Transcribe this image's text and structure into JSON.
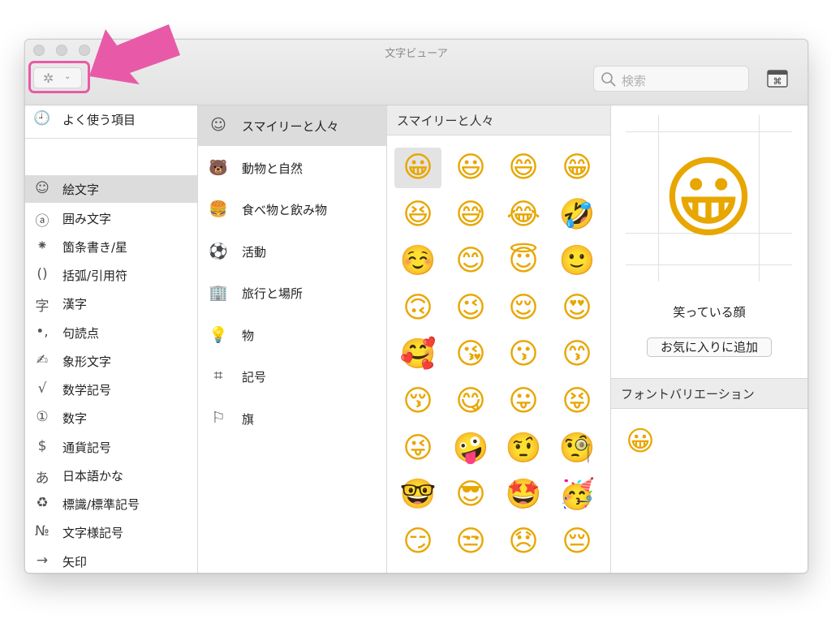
{
  "window": {
    "title": "文字ビューア"
  },
  "toolbar": {
    "gear_glyph": "✲",
    "chevron_glyph": "⌄",
    "search_placeholder": "検索",
    "keyboard_glyph": "⌘"
  },
  "colors": {
    "highlight": "#e85aa7",
    "selected_row": "#dcdcdc",
    "emoji": "#e8a600"
  },
  "categories": [
    {
      "icon": "clock-icon",
      "glyph": "🕘",
      "label": "よく使う項目"
    },
    {
      "icon": "smiley-icon",
      "glyph": "☺",
      "label": "絵文字"
    },
    {
      "icon": "circled-a-icon",
      "glyph": "ⓐ",
      "label": "囲み文字"
    },
    {
      "icon": "asterisk-icon",
      "glyph": "⁕",
      "label": "箇条書き/星"
    },
    {
      "icon": "parentheses-icon",
      "glyph": "()",
      "label": "括弧/引用符"
    },
    {
      "icon": "kanji-icon",
      "glyph": "字",
      "label": "漢字"
    },
    {
      "icon": "punctuation-icon",
      "glyph": "•,",
      "label": "句読点"
    },
    {
      "icon": "pictograph-icon",
      "glyph": "✍",
      "label": "象形文字"
    },
    {
      "icon": "sqrt-icon",
      "glyph": "√",
      "label": "数学記号"
    },
    {
      "icon": "circled-one-icon",
      "glyph": "①",
      "label": "数字"
    },
    {
      "icon": "dollar-icon",
      "glyph": "$",
      "label": "通貨記号"
    },
    {
      "icon": "hiragana-icon",
      "glyph": "あ",
      "label": "日本語かな"
    },
    {
      "icon": "recycle-icon",
      "glyph": "♻",
      "label": "標識/標準記号"
    },
    {
      "icon": "numero-icon",
      "glyph": "№",
      "label": "文字様記号"
    },
    {
      "icon": "arrow-icon",
      "glyph": "→",
      "label": "矢印"
    }
  ],
  "subcategories": [
    {
      "icon": "smiley-icon",
      "glyph": "☺",
      "label": "スマイリーと人々"
    },
    {
      "icon": "bear-icon",
      "glyph": "🐻",
      "label": "動物と自然"
    },
    {
      "icon": "food-icon",
      "glyph": "🍔",
      "label": "食べ物と飲み物"
    },
    {
      "icon": "soccer-ball-icon",
      "glyph": "⚽",
      "label": "活動"
    },
    {
      "icon": "building-icon",
      "glyph": "🏢",
      "label": "旅行と場所"
    },
    {
      "icon": "lightbulb-icon",
      "glyph": "💡",
      "label": "物"
    },
    {
      "icon": "symbols-icon",
      "glyph": "⌗",
      "label": "記号"
    },
    {
      "icon": "flag-icon",
      "glyph": "⚐",
      "label": "旗"
    }
  ],
  "grid": {
    "header": "スマイリーと人々",
    "emojis": [
      "😀",
      "😃",
      "😄",
      "😁",
      "😆",
      "😅",
      "😂",
      "🤣",
      "☺️",
      "😊",
      "😇",
      "🙂",
      "🙃",
      "😉",
      "😌",
      "😍",
      "🥰",
      "😘",
      "😗",
      "😙",
      "😚",
      "😋",
      "😛",
      "😝",
      "😜",
      "🤪",
      "🤨",
      "🧐",
      "🤓",
      "😎",
      "🤩",
      "🥳",
      "😏",
      "😒",
      "😞",
      "😔"
    ]
  },
  "detail": {
    "emoji": "😀",
    "name": "笑っている顔",
    "add_favorite": "お気に入りに追加",
    "variations_header": "フォントバリエーション",
    "variations": [
      "😀"
    ]
  }
}
